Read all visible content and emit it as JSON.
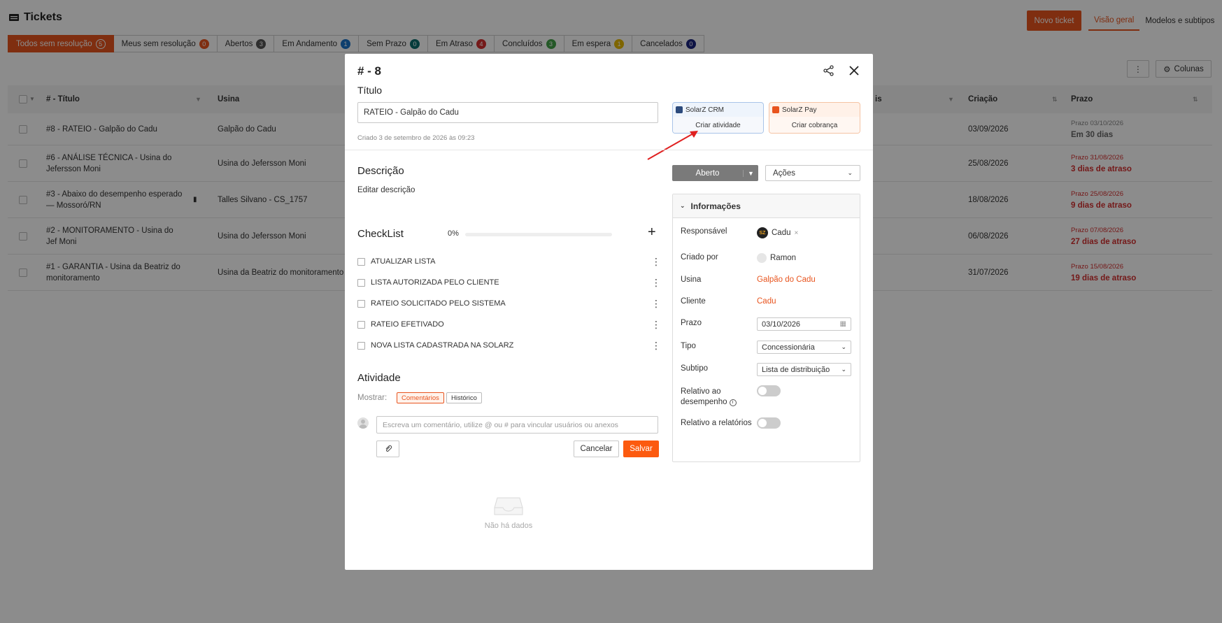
{
  "header": {
    "title": "Tickets",
    "new_ticket": "Novo ticket",
    "views": [
      "Visão geral",
      "Modelos e subtipos"
    ]
  },
  "filters": [
    {
      "label": "Todos sem resolução",
      "count": "5",
      "color": "#e8541e"
    },
    {
      "label": "Meus sem resolução",
      "count": "0",
      "color": "#e8541e"
    },
    {
      "label": "Abertos",
      "count": "3",
      "color": "#555555"
    },
    {
      "label": "Em Andamento",
      "count": "1",
      "color": "#1a73c9"
    },
    {
      "label": "Sem Prazo",
      "count": "0",
      "color": "#0b6e6e"
    },
    {
      "label": "Em Atraso",
      "count": "4",
      "color": "#d32f2f"
    },
    {
      "label": "Concluídos",
      "count": "3",
      "color": "#43a047"
    },
    {
      "label": "Em espera",
      "count": "1",
      "color": "#e6b800"
    },
    {
      "label": "Cancelados",
      "count": "0",
      "color": "#1a237e"
    }
  ],
  "toolbar": {
    "more": "⋮",
    "columns": "Colunas"
  },
  "table": {
    "headers": {
      "title": "# - Título",
      "usina": "Usina",
      "partial": "is",
      "criacao": "Criação",
      "prazo": "Prazo"
    },
    "rows": [
      {
        "title": "#8 - RATEIO - Galpão do Cadu",
        "usina": "Galpão do Cadu",
        "criacao": "03/09/2026",
        "prazo_small": "Prazo 03/10/2026",
        "prazo_big": "Em 30 dias",
        "late": false
      },
      {
        "title": "#6 - ANÁLISE TÉCNICA - Usina do Jefersson Moni",
        "usina": "Usina do Jefersson Moni",
        "criacao": "25/08/2026",
        "prazo_small": "Prazo 31/08/2026",
        "prazo_big": "3 dias de atraso",
        "late": true
      },
      {
        "title": "#3 - Abaixo do desempenho esperado — Mossoró/RN",
        "usina": "Talles Silvano - CS_1757",
        "criacao": "18/08/2026",
        "prazo_small": "Prazo 25/08/2026",
        "prazo_big": "9 dias de atraso",
        "late": true
      },
      {
        "title": "#2 - MONITORAMENTO - Usina do Jef Moni",
        "usina": "Usina do Jefersson Moni",
        "criacao": "06/08/2026",
        "prazo_small": "Prazo 07/08/2026",
        "prazo_big": "27 dias de atraso",
        "late": true
      },
      {
        "title": "#1 - GARANTIA - Usina da Beatriz do monitoramento",
        "usina": "Usina da Beatriz do monitoramento",
        "criacao": "31/07/2026",
        "prazo_small": "Prazo 15/08/2026",
        "prazo_big": "19 dias de atraso",
        "late": true
      }
    ]
  },
  "modal": {
    "id": "# - 8",
    "title_label": "Título",
    "title_value": "RATEIO - Galpão do Cadu",
    "created": "Criado 3 de setembro de 2026 às 09:23",
    "crm": {
      "name": "SolarZ CRM",
      "action": "Criar atividade"
    },
    "pay": {
      "name": "SolarZ Pay",
      "action": "Criar cobrança"
    },
    "description_label": "Descrição",
    "description_edit": "Editar descrição",
    "checklist_label": "CheckList",
    "checklist_progress": "0%",
    "checklist_progress_value": 0,
    "checklist_items": [
      "ATUALIZAR LISTA",
      "LISTA AUTORIZADA PELO CLIENTE",
      "RATEIO SOLICITADO PELO SISTEMA",
      "RATEIO EFETIVADO",
      "NOVA LISTA CADASTRADA NA SOLARZ"
    ],
    "activity_label": "Atividade",
    "show_label": "Mostrar:",
    "show_comments": "Comentários",
    "show_history": "Histórico",
    "comment_placeholder": "Escreva um comentário, utilize @ ou # para vincular usuários ou anexos",
    "cancel": "Cancelar",
    "save": "Salvar",
    "empty": "Não há dados",
    "status": "Aberto",
    "actions": "Ações",
    "info": {
      "title": "Informações",
      "responsavel_label": "Responsável",
      "responsavel_value": "Cadu",
      "criado_label": "Criado por",
      "criado_value": "Ramon",
      "usina_label": "Usina",
      "usina_value": "Galpão do Cadu",
      "cliente_label": "Cliente",
      "cliente_value": "Cadu",
      "prazo_label": "Prazo",
      "prazo_value": "03/10/2026",
      "tipo_label": "Tipo",
      "tipo_value": "Concessionária",
      "subtipo_label": "Subtipo",
      "subtipo_value": "Lista de distribuição",
      "relativo_desempenho_1": "Relativo ao",
      "relativo_desempenho_2": "desempenho",
      "relativo_desempenho_on": false,
      "relativo_relatorios": "Relativo a relatórios",
      "relativo_relatorios_on": false
    }
  },
  "colors": {
    "accent": "#e8541e",
    "late": "#d32f2f",
    "muted": "#888888"
  }
}
